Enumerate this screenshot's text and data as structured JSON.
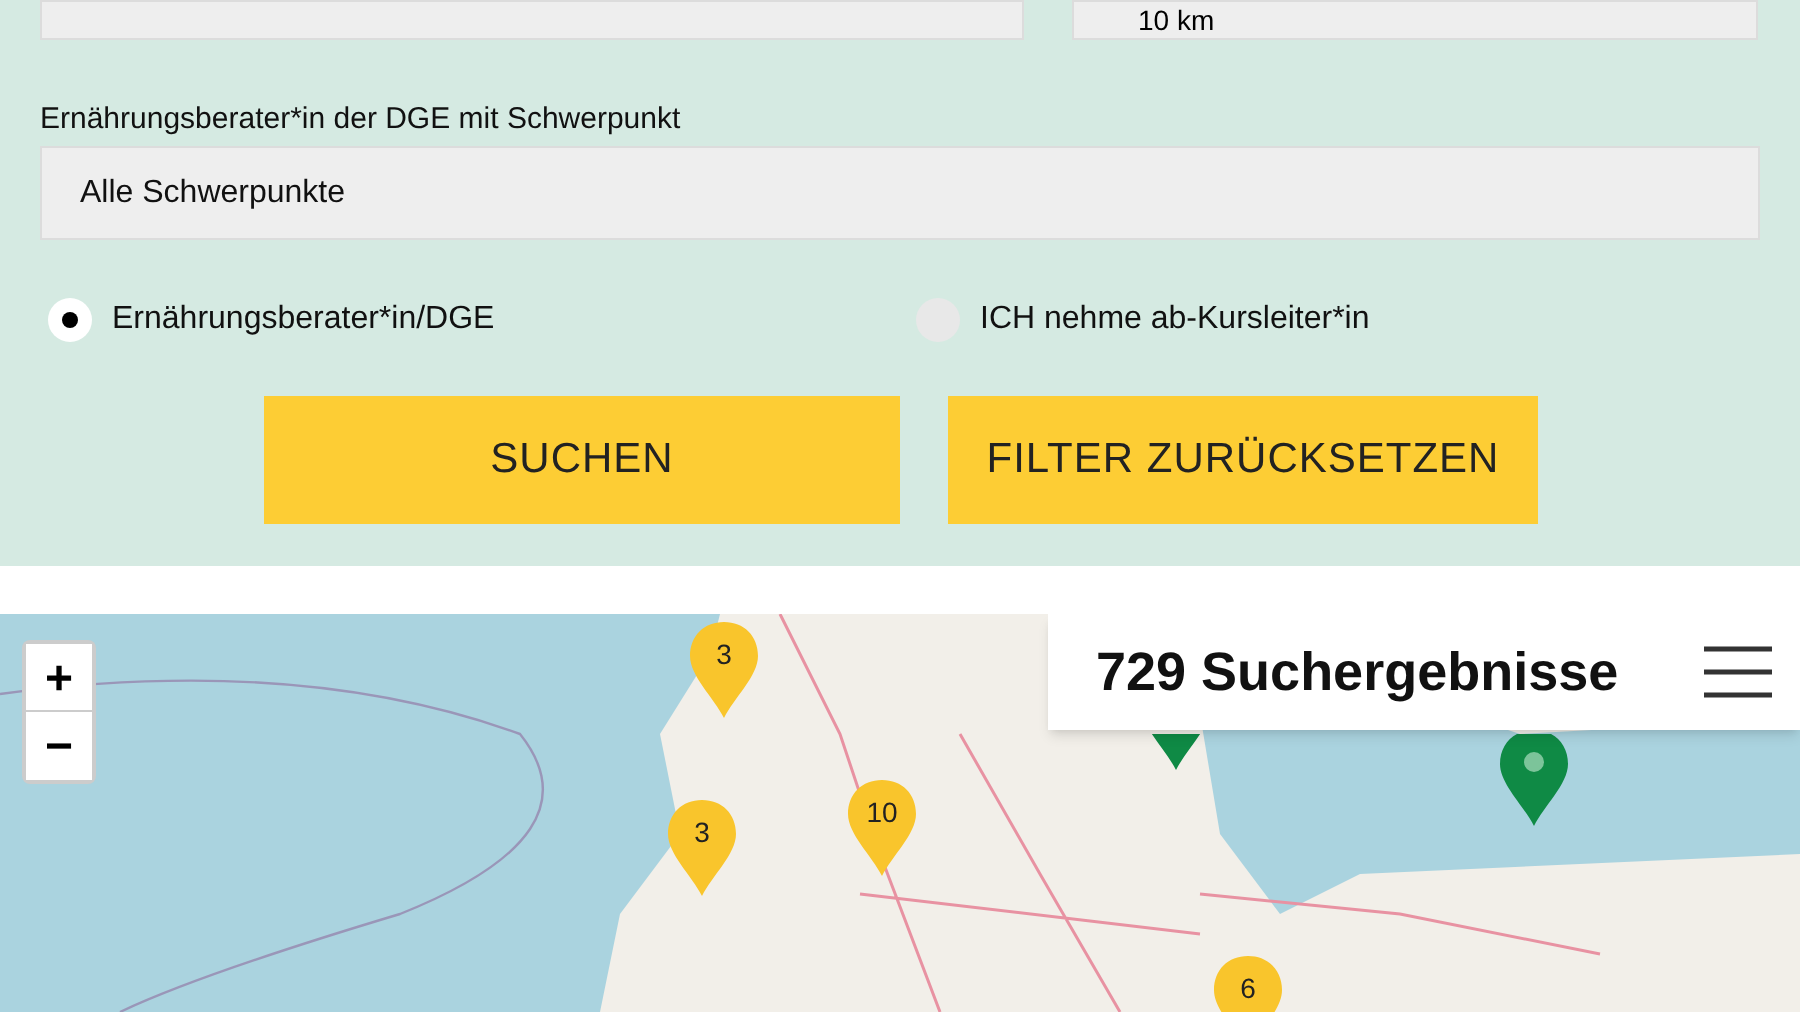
{
  "filters": {
    "distance_field": {
      "value": "10 km"
    },
    "focus": {
      "label": "Ernährungsberater*in der DGE mit Schwerpunkt",
      "value": "Alle Schwerpunkte"
    },
    "types": [
      {
        "label": "Ernährungsberater*in/DGE",
        "selected": true
      },
      {
        "label": "ICH nehme ab-Kursleiter*in",
        "selected": false
      }
    ],
    "buttons": [
      "SUCHEN",
      "FILTER ZURÜCKSETZEN"
    ]
  },
  "map": {
    "zoom_controls": [
      "+",
      "−"
    ],
    "markers": [
      {
        "kind": "cluster",
        "label": "3"
      },
      {
        "kind": "cluster",
        "label": "10"
      },
      {
        "kind": "cluster",
        "label": "3"
      },
      {
        "kind": "cluster",
        "label": "6"
      },
      {
        "kind": "pin"
      },
      {
        "kind": "pin"
      }
    ]
  },
  "results": {
    "title": "729 Suchergebnisse"
  }
}
